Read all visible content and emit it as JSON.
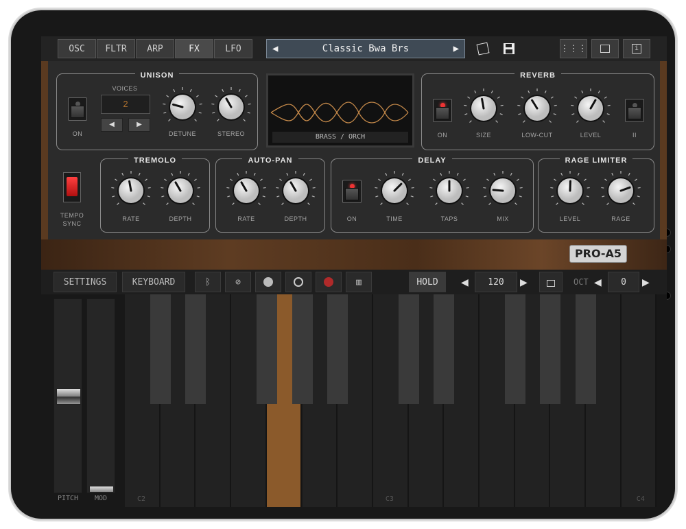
{
  "tabs": [
    "OSC",
    "FLTR",
    "ARP",
    "FX",
    "LFO"
  ],
  "selected_tab": "FX",
  "preset": {
    "name": "Classic Bwa Brs",
    "prev_icon": "triangle-left-icon",
    "next_icon": "triangle-right-icon"
  },
  "display": {
    "label": "BRASS / ORCH"
  },
  "unison": {
    "title": "UNISON",
    "voices_label": "VOICES",
    "voices_value": "2",
    "on": "ON",
    "detune": "DETUNE",
    "stereo": "STEREO"
  },
  "reverb": {
    "title": "REVERB",
    "on": "ON",
    "size": "SIZE",
    "lowcut": "LOW-CUT",
    "level": "LEVEL",
    "ii": "II"
  },
  "tremolo": {
    "title": "TREMOLO",
    "rate": "RATE",
    "depth": "DEPTH"
  },
  "tempo_sync": [
    "TEMPO",
    "SYNC"
  ],
  "autopan": {
    "title": "AUTO-PAN",
    "rate": "RATE",
    "depth": "DEPTH"
  },
  "delay": {
    "title": "DELAY",
    "on": "ON",
    "time": "TIME",
    "taps": "TAPS",
    "mix": "MIX"
  },
  "limiter": {
    "title": "RAGE LIMITER",
    "level": "LEVEL",
    "rage": "RAGE"
  },
  "logo": "PRO-A5",
  "controls": {
    "settings": "SETTINGS",
    "keyboard": "KEYBOARD",
    "hold": "HOLD",
    "tempo": "120",
    "oct_label": "OCT",
    "oct": "0"
  },
  "keys": {
    "c2": "C2",
    "c3": "C3",
    "c4": "C4"
  },
  "sliders": {
    "pitch": "PITCH",
    "mod": "MOD"
  },
  "colors": {
    "accent": "#8b5a2b",
    "led": "#e33333"
  }
}
